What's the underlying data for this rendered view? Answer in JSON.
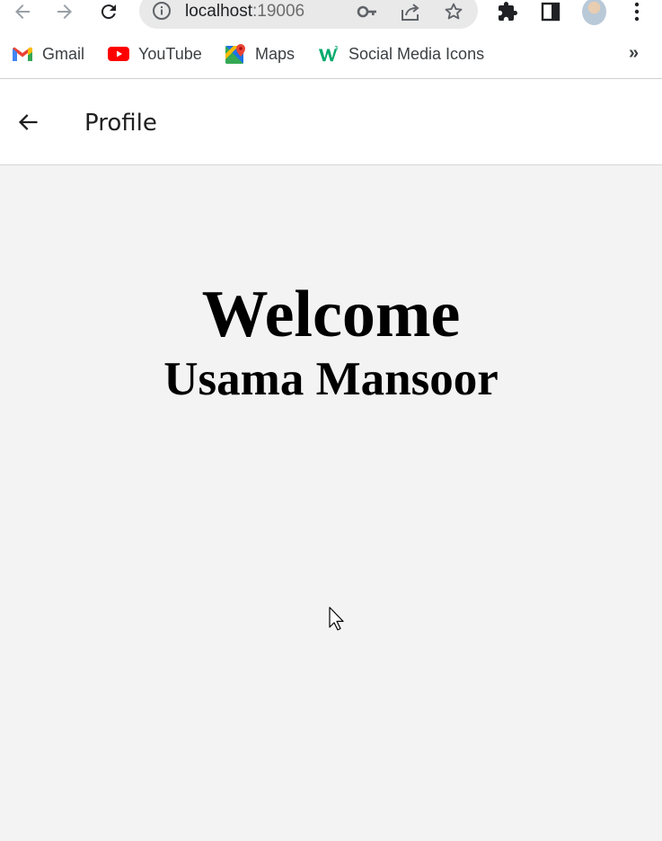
{
  "browser": {
    "url_host": "localhost",
    "url_port": ":19006",
    "icons": {
      "back": "arrow-left-icon",
      "forward": "arrow-right-icon",
      "reload": "reload-icon",
      "site_info": "info-icon",
      "password": "key-icon",
      "share": "share-icon",
      "bookmark": "star-icon",
      "extensions": "puzzle-icon",
      "side_panel": "side-panel-icon",
      "menu": "kebab-menu-icon"
    }
  },
  "bookmarks": {
    "items": [
      {
        "label": "Gmail",
        "icon": "gmail-icon"
      },
      {
        "label": "YouTube",
        "icon": "youtube-icon"
      },
      {
        "label": "Maps",
        "icon": "maps-icon"
      },
      {
        "label": "Social Media Icons",
        "icon": "w3schools-icon"
      }
    ],
    "overflow_label": "»"
  },
  "app": {
    "header_title": "Profile",
    "back_icon": "arrow-left-icon",
    "welcome_text": "Welcome",
    "user_name": "Usama Mansoor"
  },
  "colors": {
    "page_background": "#f3f3f3",
    "header_background": "#ffffff",
    "youtube_red": "#ff0000",
    "w3_green": "#04aa6d"
  }
}
